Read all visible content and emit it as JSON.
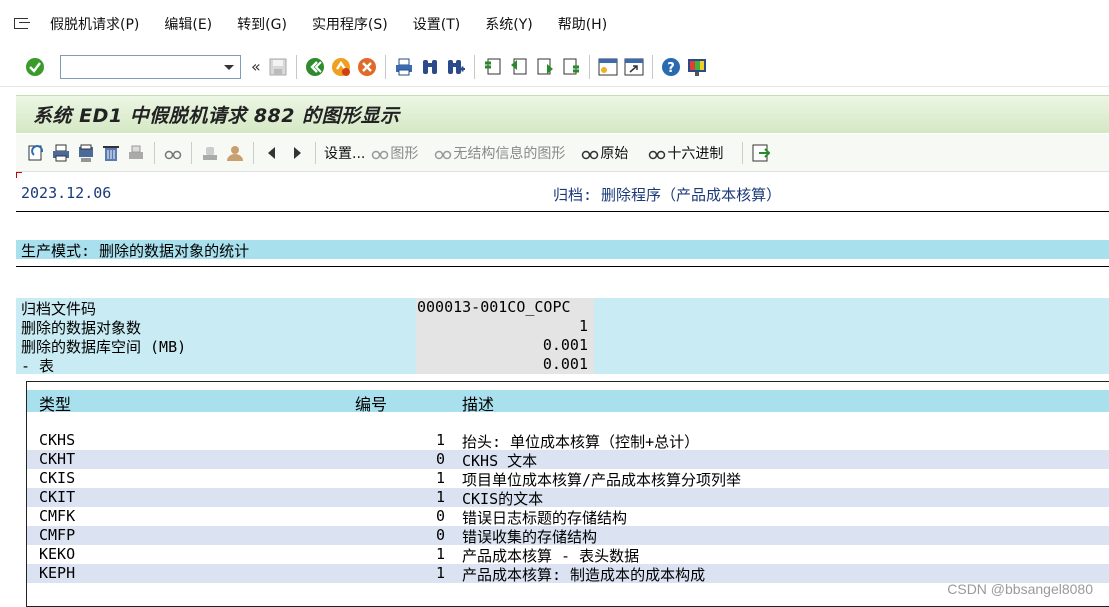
{
  "menu": {
    "items": [
      "假脱机请求(P)",
      "编辑(E)",
      "转到(G)",
      "实用程序(S)",
      "设置(T)",
      "系统(Y)",
      "帮助(H)"
    ]
  },
  "systoolbar": {
    "command_value": "",
    "icons": [
      "enter-icon",
      "back-chevrons-icon",
      "save-icon",
      "back-icon",
      "exit-icon",
      "cancel-icon",
      "print-icon",
      "find-icon",
      "find-next-icon",
      "first-page-icon",
      "prev-page-icon",
      "next-page-icon",
      "last-page-icon",
      "new-session-icon",
      "shortcut-icon",
      "help-icon",
      "customize-layout-icon"
    ]
  },
  "title": "系统 ED1 中假脱机请求 882 的图形显示",
  "apptoolbar": {
    "settings": "设置...",
    "graphic": "图形",
    "graphic_no_struct": "无结构信息的图形",
    "raw": "原始",
    "hex": "十六进制"
  },
  "report": {
    "date": "2023.12.06",
    "archive_heading": "归档: 删除程序（产品成本核算）",
    "production_mode": "生产模式: 删除的数据对象的统计",
    "stats": [
      {
        "label": "归档文件码",
        "value": "000013-001CO_COPC"
      },
      {
        "label": "删除的数据对象数",
        "value": "1"
      },
      {
        "label": "删除的数据库空间 (MB)",
        "value": "0.001"
      },
      {
        "label": "- 表",
        "value": "0.001"
      }
    ],
    "table": {
      "headers": {
        "type": "类型",
        "number": "编号",
        "desc": "描述"
      },
      "rows": [
        {
          "type": "CKHS",
          "number": "1",
          "desc": "抬头: 单位成本核算（控制+总计）"
        },
        {
          "type": "CKHT",
          "number": "0",
          "desc": "CKHS 文本"
        },
        {
          "type": "CKIS",
          "number": "1",
          "desc": "项目单位成本核算/产品成本核算分项列举"
        },
        {
          "type": "CKIT",
          "number": "1",
          "desc": "CKIS的文本"
        },
        {
          "type": "CMFK",
          "number": "0",
          "desc": "错误日志标题的存储结构"
        },
        {
          "type": "CMFP",
          "number": "0",
          "desc": "错误收集的存储结构"
        },
        {
          "type": "KEKO",
          "number": "1",
          "desc": "产品成本核算 - 表头数据"
        },
        {
          "type": "KEPH",
          "number": "1",
          "desc": "产品成本核算: 制造成本的成本构成"
        }
      ]
    }
  },
  "watermark": "CSDN @bbsangel8080"
}
